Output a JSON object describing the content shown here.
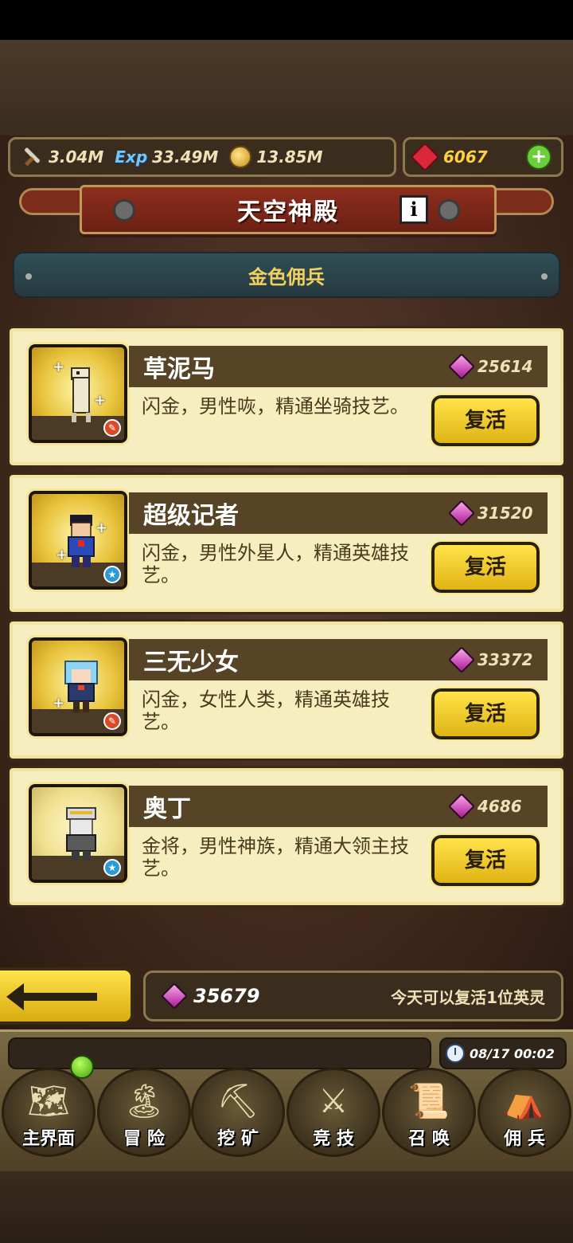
{
  "resources": {
    "attack": "3.04M",
    "exp_label": "Exp",
    "exp": "33.49M",
    "gold": "13.85M",
    "ruby": "6067",
    "plus": "+"
  },
  "banner": {
    "title": "天空神殿",
    "info": "i"
  },
  "category": "金色佣兵",
  "heroes": [
    {
      "name": "草泥马",
      "cost": "25614",
      "desc": "闪金，男性咴，精通坐骑技艺。",
      "button": "复活",
      "badge": "red"
    },
    {
      "name": "超级记者",
      "cost": "31520",
      "desc": "闪金，男性外星人，精通英雄技艺。",
      "button": "复活",
      "badge": "blue"
    },
    {
      "name": "三无少女",
      "cost": "33372",
      "desc": "闪金，女性人类，精通英雄技艺。",
      "button": "复活",
      "badge": "red"
    },
    {
      "name": "奥丁",
      "cost": "4686",
      "desc": "金将，男性神族，精通大领主技艺。",
      "button": "复活",
      "badge": "blue"
    }
  ],
  "footer": {
    "gems": "35679",
    "note": "今天可以复活1位英灵"
  },
  "clock": "08/17 00:02",
  "nav": [
    {
      "label": "主界面",
      "icon": "map-scroll-icon"
    },
    {
      "label": "冒 险",
      "icon": "island-icon"
    },
    {
      "label": "挖 矿",
      "icon": "pickaxe-icon"
    },
    {
      "label": "竞 技",
      "icon": "crossed-swords-icon"
    },
    {
      "label": "召 唤",
      "icon": "summon-scroll-icon"
    },
    {
      "label": "佣 兵",
      "icon": "tent-icon"
    }
  ],
  "colors": {
    "accent_gold": "#f2d060",
    "button_yellow": "#ffe34a",
    "banner_red": "#8e2f1e",
    "card_bg": "#f6eebe"
  }
}
